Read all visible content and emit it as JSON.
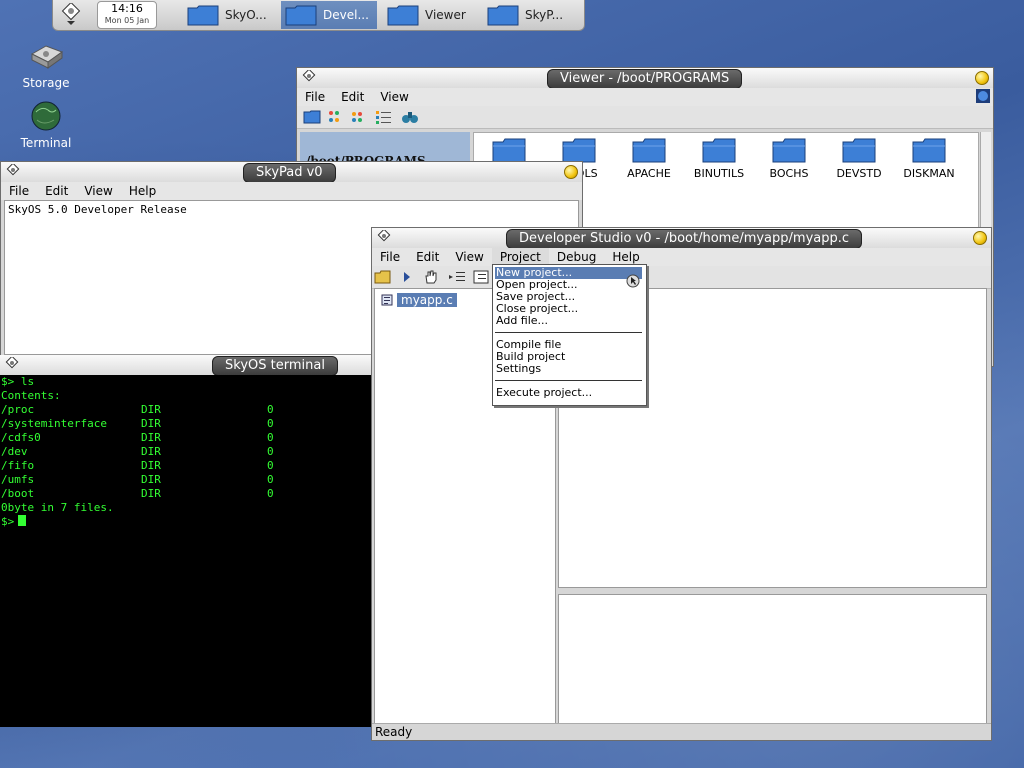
{
  "taskbar": {
    "clock": {
      "time": "14:16",
      "date": "Mon 05 Jan"
    },
    "buttons": [
      "SkyO...",
      "Devel...",
      "Viewer",
      "SkyP..."
    ]
  },
  "desktop_icons": [
    "Storage",
    "Terminal"
  ],
  "viewer": {
    "title": "Viewer - /boot/PROGRAMS",
    "menu": [
      "File",
      "Edit",
      "View"
    ],
    "path": "/boot/PROGRAMS",
    "folders": [
      "TOOLS",
      "APACHE",
      "BINUTILS",
      "BOCHS",
      "DEVSTD",
      "DISKMAN"
    ]
  },
  "skypad": {
    "title": "SkyPad v0",
    "menu": [
      "File",
      "Edit",
      "View",
      "Help"
    ],
    "text": "SkyOS 5.0 Developer Release"
  },
  "terminal": {
    "title": "SkyOS terminal",
    "command": "$> ls",
    "heading": "Contents:",
    "rows": [
      {
        "name": "/proc",
        "type": "DIR",
        "size": "0"
      },
      {
        "name": "/systeminterface",
        "type": "DIR",
        "size": "0"
      },
      {
        "name": "/cdfs0",
        "type": "DIR",
        "size": "0"
      },
      {
        "name": "/dev",
        "type": "DIR",
        "size": "0"
      },
      {
        "name": "/fifo",
        "type": "DIR",
        "size": "0"
      },
      {
        "name": "/umfs",
        "type": "DIR",
        "size": "0"
      },
      {
        "name": "/boot",
        "type": "DIR",
        "size": "0"
      }
    ],
    "summary": "0byte in 7 files.",
    "prompt": "$>"
  },
  "devstudio": {
    "title": "Developer Studio v0 - /boot/home/myapp/myapp.c",
    "menu": [
      "File",
      "Edit",
      "View",
      "Project",
      "Debug",
      "Help"
    ],
    "tree_item": "myapp.c",
    "status": "Ready",
    "project_menu": {
      "items_a": [
        "New project...",
        "Open project...",
        "Save project...",
        "Close project...",
        "Add file..."
      ],
      "items_b": [
        "Compile file",
        "Build project",
        "Settings"
      ],
      "items_c": [
        "Execute project..."
      ]
    }
  }
}
